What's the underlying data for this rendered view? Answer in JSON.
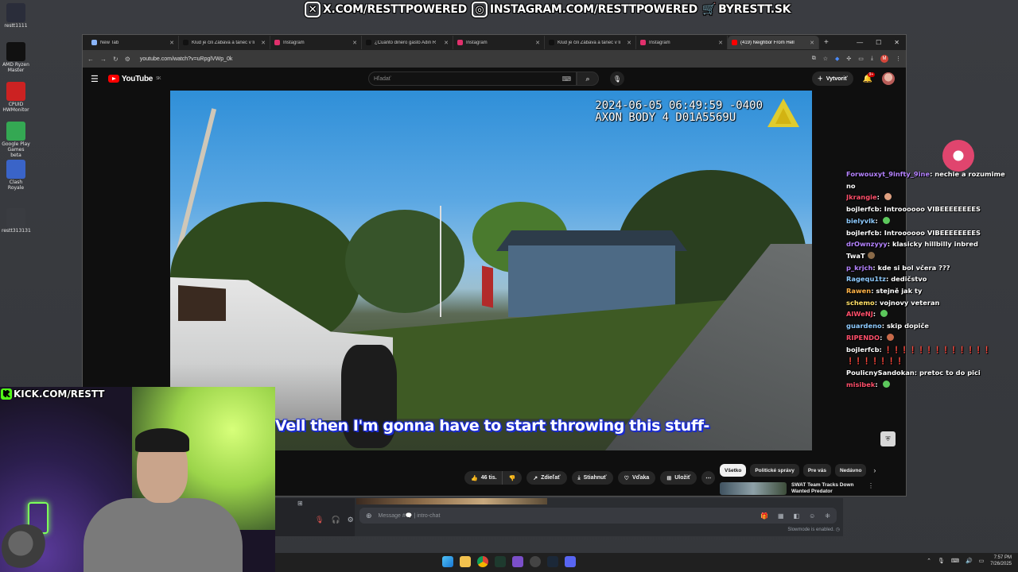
{
  "brand_bar": [
    {
      "icon": "x-icon",
      "label": "X.COM/RESTTPOWERED"
    },
    {
      "icon": "instagram-icon",
      "label": "INSTAGRAM.COM/RESTTPOWERED"
    },
    {
      "icon": "cart-icon",
      "label": "BYRESTT.SK"
    }
  ],
  "desktop": {
    "icons": [
      {
        "label": "restt1111",
        "color": "#2a2d3a"
      },
      {
        "label": "AMD Ryzen Master",
        "color": "#111111"
      },
      {
        "label": "CPUID HWMonitor",
        "color": "#cc2222"
      },
      {
        "label": "Google Play Games beta",
        "color": "#34a853"
      },
      {
        "label": "Clash Royale",
        "color": "#3a64c8"
      },
      {
        "label": "restt313131",
        "color": "#3a3c41"
      }
    ]
  },
  "browser": {
    "tabs": [
      {
        "label": "New Tab",
        "favicon": "#8ab4f8",
        "active": false
      },
      {
        "label": "Klud je čili Zábava a tanec v li",
        "favicon": "#111111",
        "active": false
      },
      {
        "label": "Instagram",
        "favicon": "#e1306c",
        "active": false
      },
      {
        "label": "¿Cuánto dinero gastó Adin R",
        "favicon": "#111111",
        "active": false
      },
      {
        "label": "Instagram",
        "favicon": "#e1306c",
        "active": false
      },
      {
        "label": "Klud je čili Zábava a tanec v li",
        "favicon": "#111111",
        "active": false
      },
      {
        "label": "Instagram",
        "favicon": "#e1306c",
        "active": false
      },
      {
        "label": "(419) Neighbor From Hell",
        "favicon": "#ff0000",
        "active": true
      }
    ],
    "url": "youtube.com/watch?v=uRpglVWp_0k"
  },
  "youtube": {
    "logo_text": "YouTube",
    "logo_sup": "SK",
    "search_placeholder": "Hľadať",
    "create_label": "Vytvoriť",
    "notif_count": "9+"
  },
  "video": {
    "timestamp_line1": "2024-06-05 06:49:59 -0400",
    "timestamp_line2": "AXON BODY 4 D01A5569U",
    "subtitle": "Vell then I'm gonna have to start throwing this stuff-"
  },
  "actions": {
    "like_count": "46 tis.",
    "share": "Zdieľať",
    "download": "Stiahnuť",
    "thanks": "Vďaka",
    "save": "Uložiť"
  },
  "chips": [
    "Všetko",
    "Politické správy",
    "Pre vás",
    "Nedávno"
  ],
  "recommendation": {
    "title": "SWAT Team Tracks Down Wanted Predator"
  },
  "chat": [
    {
      "user": "Forwouxyt_9infty_9ine",
      "color": "#b583ff",
      "text": "nechie a rozumime"
    },
    {
      "user": "",
      "color": "#ffffff",
      "text": "no"
    },
    {
      "user": "Jkrangie",
      "color": "#ff4f6a",
      "text": "",
      "emote": "#e0a080"
    },
    {
      "user": "bojlerfcb",
      "color": "#ffffff",
      "text": "Introooooo VIBEEEEEEEES"
    },
    {
      "user": "bielyvlk",
      "color": "#8ecbff",
      "text": "",
      "emote": "#5cc85c"
    },
    {
      "user": "bojlerfcb",
      "color": "#ffffff",
      "text": "Introooooo VIBEEEEEEEES"
    },
    {
      "user": "drOwnzyyy",
      "color": "#b583ff",
      "text": "klasicky hillbilly inbred"
    },
    {
      "user": "",
      "color": "#ffffff",
      "text": "TwaT",
      "emote": "#8a6a48"
    },
    {
      "user": "p_krjch",
      "color": "#b583ff",
      "text": "kde si bol včera ???"
    },
    {
      "user": "Ragequ1tz",
      "color": "#8ecbff",
      "text": "dedičstvo"
    },
    {
      "user": "Rawen",
      "color": "#ffb347",
      "text": "stejně jak ty"
    },
    {
      "user": "schemo",
      "color": "#ffe066",
      "text": "vojnovy veteran"
    },
    {
      "user": "AlWeNJ",
      "color": "#ff4f6a",
      "text": "",
      "emote": "#5cc85c"
    },
    {
      "user": "guardeno",
      "color": "#8ecbff",
      "text": "skip dopiče"
    },
    {
      "user": "RIPENDO",
      "color": "#ff4f6a",
      "text": "",
      "emote": "#c86a4a"
    },
    {
      "user": "bojlerfcb",
      "color": "#ffffff",
      "text": "❗❗❗❗❗❗❗❗❗❗❗❗❗"
    },
    {
      "user": "",
      "color": "#ffffff",
      "text": "❗❗❗❗❗❗❗"
    },
    {
      "user": "PoulicnySandokan",
      "color": "#ffffff",
      "text": "pretoc to do pici"
    },
    {
      "user": "misibek",
      "color": "#ff4f6a",
      "text": "",
      "emote": "#5cc85c"
    }
  ],
  "discord": {
    "message_placeholder": "Message #🗨️ | intro-chat",
    "slowmode": "Slowmode is enabled."
  },
  "kick": {
    "label": "KICK.COM/RESTT"
  },
  "taskbar": {
    "time": "7:57 PM",
    "date": "7/26/2025"
  }
}
